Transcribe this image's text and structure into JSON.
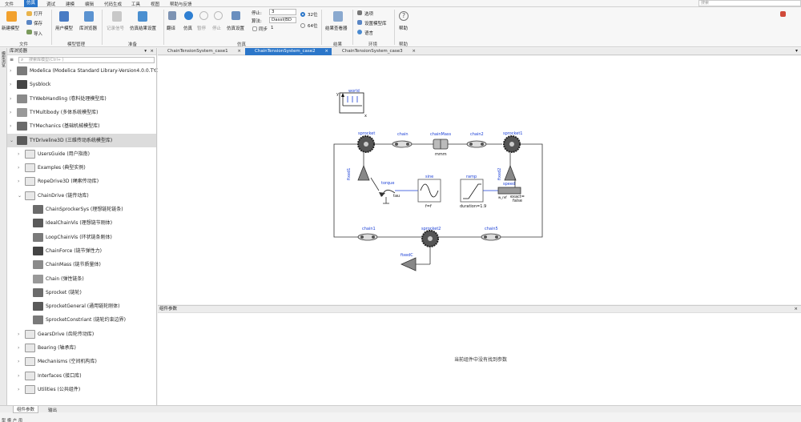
{
  "menu": {
    "items": [
      "文件",
      "仿真",
      "调试",
      "建模",
      "编辑",
      "代码生成",
      "工具",
      "视图",
      "帮助与反馈"
    ],
    "active_index": 1,
    "search_placeholder": "搜索"
  },
  "ribbon": {
    "file": {
      "new": "新建模型",
      "open": "打开",
      "save": "保存",
      "import": "导入",
      "group": "文件"
    },
    "model_mgmt": {
      "user_model": "用户模型",
      "lib_browser": "库浏览器",
      "group": "模型管理"
    },
    "prepare": {
      "record_signal": "记录信号",
      "sim_result_settings": "仿真结果设置",
      "group": "准备"
    },
    "simulation": {
      "translate": "翻译",
      "simulate": "仿真",
      "pause": "暂停",
      "stop": "停止",
      "sim_settings": "仿真设置",
      "stop_time_label": "停止:",
      "stop_time_value": "3",
      "algorithm_label": "算法:",
      "algorithm_value": "Dassl(BD",
      "sync_label": "同步",
      "sync_value": "1",
      "bit32": "32位",
      "bit64": "64位",
      "group": "仿真"
    },
    "result": {
      "viewer": "结果查看器",
      "group": "结果"
    },
    "env": {
      "options": "选项",
      "set_model_lib": "设置模型库",
      "language": "语言",
      "group": "环境"
    },
    "help": {
      "help": "帮助",
      "group": "帮助"
    }
  },
  "left_strip": {
    "top": "模型浏览",
    "bottom": "用户模型"
  },
  "library": {
    "title": "库浏览器",
    "search_placeholder": "搜索库模型(Ctrl+ )",
    "items": [
      {
        "label": "Modelica (Modelica Standard Library-Version4.0.0.TY.1)",
        "level": 0,
        "expanded": false
      },
      {
        "label": "Sysblock",
        "level": 0,
        "expanded": false
      },
      {
        "label": "TYWebHandling (卷料处理模型库)",
        "level": 0,
        "expanded": false
      },
      {
        "label": "TYMultibody (多体系统模型库)",
        "level": 0,
        "expanded": false
      },
      {
        "label": "TYMechanics (基础机械模型库)",
        "level": 0,
        "expanded": false
      },
      {
        "label": "TYDriveline3D (三维传动系统模型库)",
        "level": 0,
        "expanded": true,
        "selected": true
      },
      {
        "label": "UsersGuide (用户指南)",
        "level": 1,
        "expanded": false
      },
      {
        "label": "Examples (典型实例)",
        "level": 1,
        "expanded": false
      },
      {
        "label": "RopeDrive3D (绳索传动库)",
        "level": 1,
        "expanded": false
      },
      {
        "label": "ChainDrive (链传动库)",
        "level": 1,
        "expanded": true
      },
      {
        "label": "ChainSprockerSys (理想链轮链条)",
        "level": 2
      },
      {
        "label": "IdealChainVis (理想链节刚体)",
        "level": 2
      },
      {
        "label": "LoopChainVis (环状链条刚体)",
        "level": 2
      },
      {
        "label": "ChainForce (链节弹性力)",
        "level": 2
      },
      {
        "label": "ChainMass (链节质量体)",
        "level": 2
      },
      {
        "label": "Chain (弹性链条)",
        "level": 2
      },
      {
        "label": "Sprocket (链轮)",
        "level": 2
      },
      {
        "label": "SprocketGeneral (通用链轮刚体)",
        "level": 2
      },
      {
        "label": "SprocketConstriant (链轮约束边界)",
        "level": 2
      },
      {
        "label": "GearsDrive (齿轮传动库)",
        "level": 1,
        "expanded": false
      },
      {
        "label": "Bearing (轴承库)",
        "level": 1,
        "expanded": false
      },
      {
        "label": "Mechanisms (空间机构库)",
        "level": 1,
        "expanded": false
      },
      {
        "label": "Interfaces (接口库)",
        "level": 1,
        "expanded": false
      },
      {
        "label": "Utilities (公共组件)",
        "level": 1,
        "expanded": false
      }
    ]
  },
  "tabs": [
    {
      "label": "ChainTensionSystem_case1",
      "active": false
    },
    {
      "label": "ChainTensionSystem_case2",
      "active": true
    },
    {
      "label": "ChainTensionSystem_case3",
      "active": false
    }
  ],
  "diagram": {
    "world": "world",
    "world_y": "y",
    "world_x": "x",
    "sprocket": "sprocket",
    "chain": "chain",
    "chainMass": "chainMass",
    "mmm": "mmm",
    "chain2": "chain2",
    "sprocket1": "sprocket1",
    "fixed1": "fixed1",
    "fixed2": "fixed2",
    "torque": "torque",
    "tau": "tau",
    "sine": "sine",
    "f": "f=f",
    "ramp": "ramp",
    "duration": "duration=1.9",
    "speed": "speed",
    "exact": "exact=",
    "false": "false",
    "chain1": "chain1",
    "sprocket2": "sprocket2",
    "chain5": "chain5",
    "fixedC": "fixedC",
    "w_ref": "w_ref"
  },
  "params": {
    "title": "组件参数",
    "empty_message": "当前组件中没有找到参数"
  },
  "bottom_tabs": [
    {
      "label": "组件参数",
      "active": true
    },
    {
      "label": "输出",
      "active": false
    }
  ]
}
